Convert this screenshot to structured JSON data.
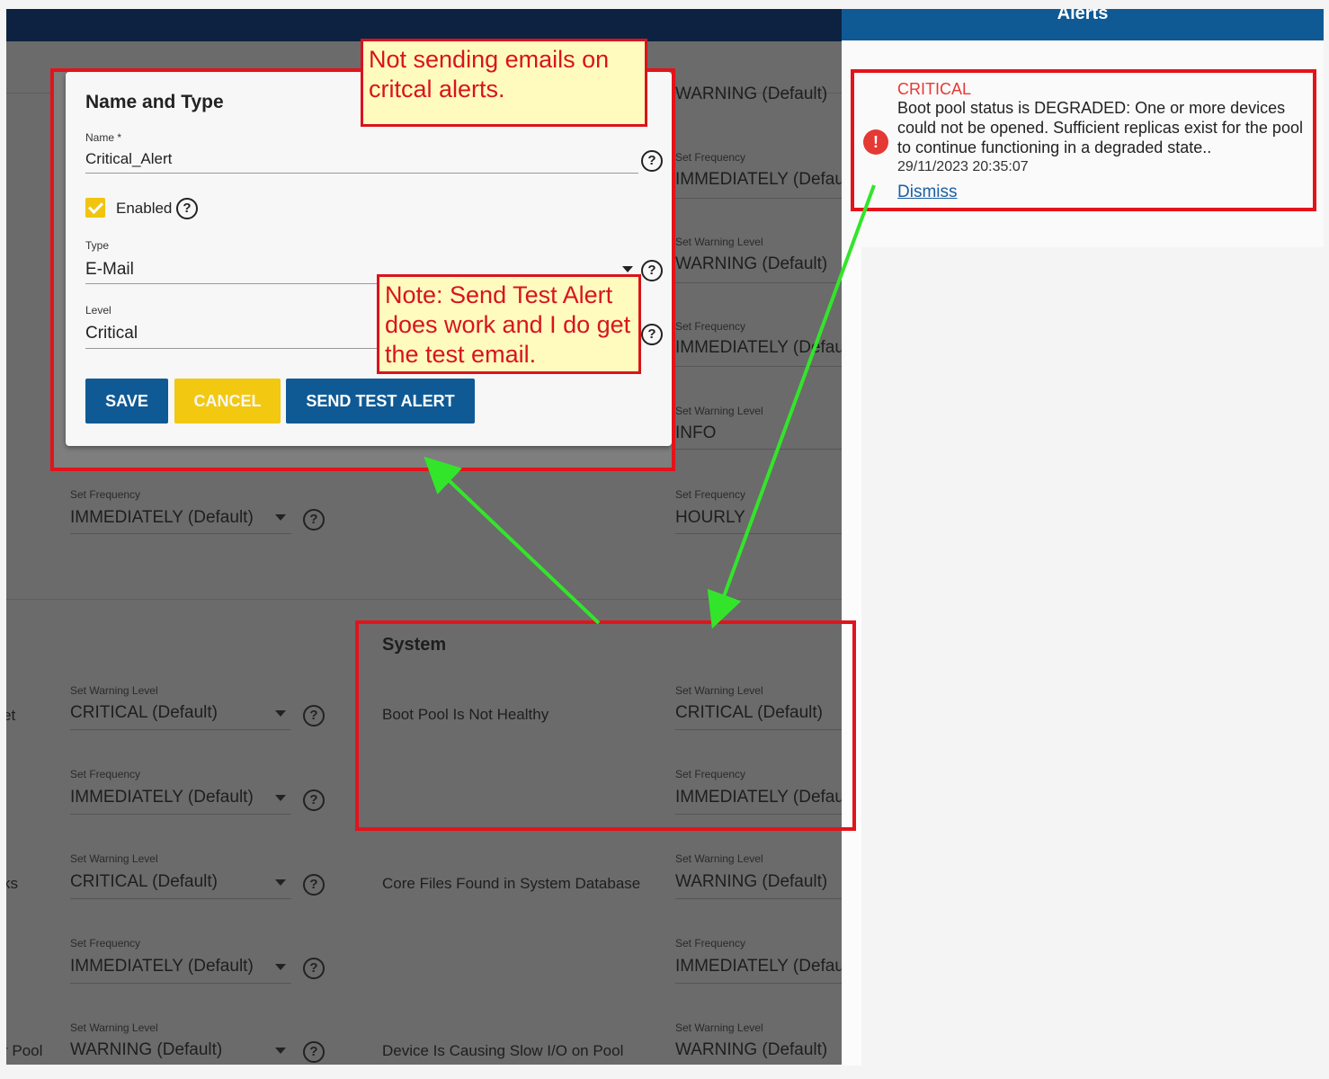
{
  "alerts_panel": {
    "title": "Alerts",
    "alert": {
      "level": "CRITICAL",
      "message": "Boot pool status is DEGRADED: One or more devices could not be opened. Sufficient replicas exist for the pool to continue functioning in a degraded state..",
      "timestamp": "29/11/2023 20:35:07",
      "dismiss_label": "Dismiss",
      "icon": "error-icon"
    }
  },
  "dialog": {
    "section_title": "Name and Type",
    "name_label": "Name *",
    "name_value": "Critical_Alert",
    "enabled_label": "Enabled",
    "type_label": "Type",
    "type_value": "E-Mail",
    "level_label": "Level",
    "level_value": "Critical",
    "save_label": "SAVE",
    "cancel_label": "CANCEL",
    "test_label": "SEND TEST ALERT"
  },
  "background": {
    "right_col_top": [
      {
        "label": "",
        "value": "WARNING (Default)"
      },
      {
        "label": "Set Frequency",
        "value": "IMMEDIATELY (Defau"
      },
      {
        "label": "Set Warning Level",
        "value": "WARNING (Default)"
      },
      {
        "label": "Set Frequency",
        "value": "IMMEDIATELY (Defau"
      },
      {
        "label": "Set Warning Level",
        "value": "INFO"
      },
      {
        "label": "Set Frequency",
        "value": "HOURLY"
      }
    ],
    "left_freq": {
      "label": "Set Frequency",
      "value": "IMMEDIATELY (Default)"
    },
    "system_section": "System",
    "left_rows": [
      {
        "label": "Set Warning Level",
        "value": "CRITICAL (Default)",
        "edge": "et"
      },
      {
        "label": "Set Frequency",
        "value": "IMMEDIATELY (Default)",
        "edge": ""
      },
      {
        "label": "Set Warning Level",
        "value": "CRITICAL (Default)",
        "edge": "ks"
      },
      {
        "label": "Set Frequency",
        "value": "IMMEDIATELY (Default)",
        "edge": ""
      },
      {
        "label": "Set Warning Level",
        "value": "WARNING (Default)",
        "edge": "r Pool"
      }
    ],
    "middle_rows": [
      "Boot Pool Is Not Healthy",
      "Core Files Found in System Database",
      "Device Is Causing Slow I/O on Pool"
    ],
    "right_rows": [
      {
        "label": "Set Warning Level",
        "value": "CRITICAL (Default)"
      },
      {
        "label": "Set Frequency",
        "value": "IMMEDIATELY (Defau"
      },
      {
        "label": "Set Warning Level",
        "value": "WARNING (Default)"
      },
      {
        "label": "Set Frequency",
        "value": "IMMEDIATELY (Defau"
      },
      {
        "label": "Set Warning Level",
        "value": "WARNING (Default)"
      }
    ]
  },
  "annotations": {
    "note1": "Not sending emails on critcal alerts.",
    "note2": "Note: Send Test Alert does work and I do get the test email."
  },
  "colors": {
    "annotation_red": "#e3131b",
    "arrow_green": "#33e52a",
    "primary_blue": "#0f5a95",
    "accent_yellow": "#f2c811"
  }
}
